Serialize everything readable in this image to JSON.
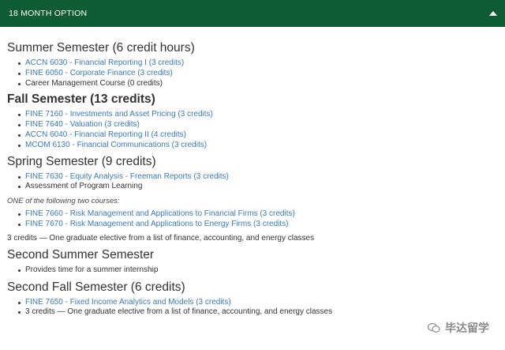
{
  "header": {
    "title": "18 MONTH OPTION"
  },
  "sections": {
    "summer": {
      "title": "Summer Semester (6 credit hours)",
      "items": [
        "ACCN 6030 - Financial Reporting I (3 credits)",
        "FINE 6050 - Corporate Finance (3 credits)",
        "Career Management Course (0 credits)"
      ]
    },
    "fall": {
      "title": "Fall Semester (13 credits)",
      "items": [
        "FINE 7160 - Investments and Asset Pricing (3 credits)",
        "FINE 7640 - Valuation (3 credits)",
        "ACCN 6040 - Financial Reporting II (4 credits)",
        "MCOM 6130 - Financial Communications (3 credits)"
      ]
    },
    "spring": {
      "title": "Spring Semester (9 credits)",
      "items": [
        "FINE 7630 - Equity Analysis - Freeman Reports (3 credits)",
        "Assessment of Program Learning"
      ],
      "note": "ONE of the following two courses:",
      "choice_items": [
        "FINE 7660 - Risk Management and Applications to Financial Firms (3 credits)",
        "FINE 7670 - Risk Management and Applications to Energy Firms (3 credits)"
      ],
      "elective": "3 credits — One graduate elective from a list of finance, accounting, and energy classes"
    },
    "second_summer": {
      "title": "Second Summer Semester",
      "items": [
        "Provides time for a summer internship"
      ]
    },
    "second_fall": {
      "title": "Second Fall Semester (6 credits)",
      "items": [
        "FINE 7650 - Fixed Income Analytics and Models (3 credits)",
        "3 credits — One graduate elective from a list of finance, accounting, and energy classes"
      ]
    }
  },
  "watermark": {
    "text": "毕达留学"
  }
}
